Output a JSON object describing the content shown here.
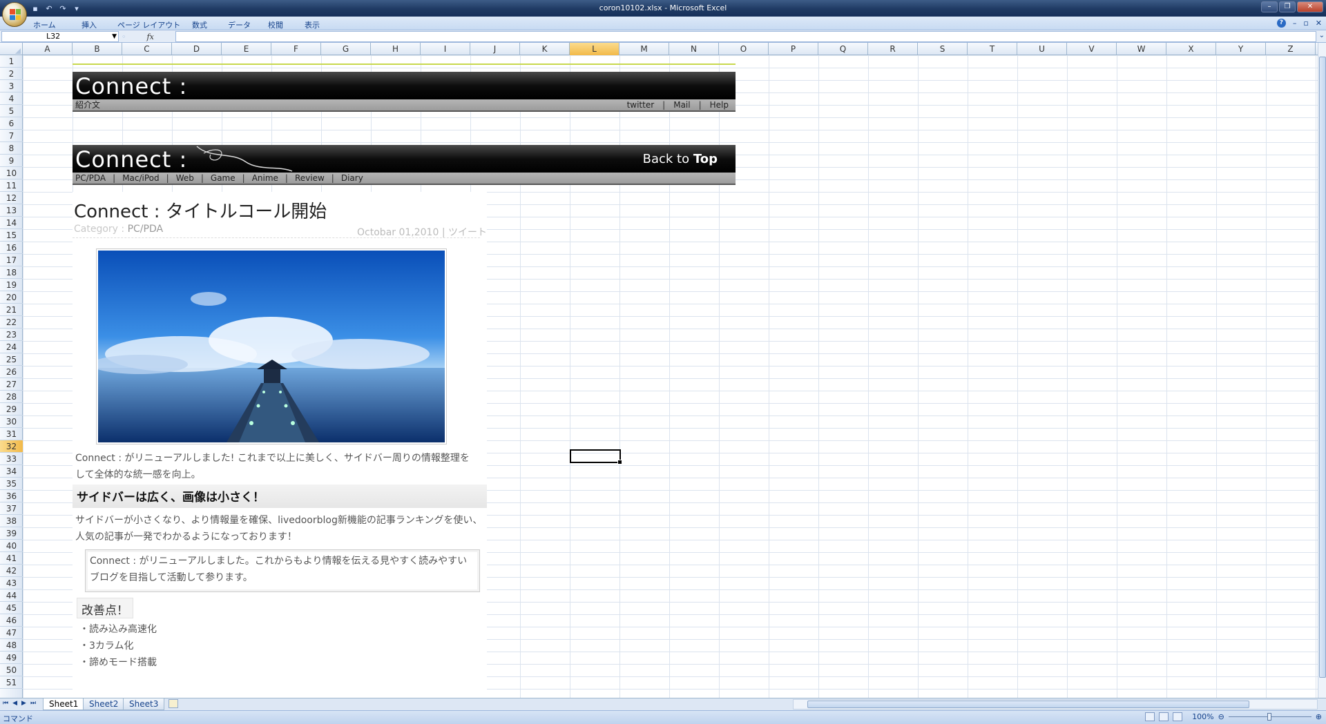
{
  "window": {
    "title": "coron10102.xlsx - Microsoft Excel"
  },
  "ribbon": {
    "tabs": [
      "ホーム",
      "挿入",
      "ページ レイアウト",
      "数式",
      "データ",
      "校閲",
      "表示"
    ]
  },
  "formula_bar": {
    "name_box": "L32",
    "formula": ""
  },
  "grid": {
    "columns": [
      "A",
      "B",
      "C",
      "D",
      "E",
      "F",
      "G",
      "H",
      "I",
      "J",
      "K",
      "L",
      "M",
      "N",
      "O",
      "P",
      "Q",
      "R",
      "S",
      "T",
      "U",
      "V",
      "W",
      "X",
      "Y",
      "Z"
    ],
    "active_column": "L",
    "active_row": 32,
    "row_count": 51
  },
  "header1": {
    "brand": "Connect :",
    "intro": "紹介文",
    "links": [
      "twitter",
      "Mail",
      "Help"
    ]
  },
  "header2": {
    "brand": "Connect :",
    "back_to": "Back to",
    "top": "Top",
    "nav": [
      "PC/PDA",
      "Mac/iPod",
      "Web",
      "Game",
      "Anime",
      "Review",
      "Diary"
    ]
  },
  "article": {
    "title": "Connect : タイトルコール開始",
    "category_label": "Category :",
    "category": "PC/PDA",
    "date": "Octobar 01,2010",
    "tweet": "ツイート",
    "p1": "Connect : がリニューアルしました! これまで以上に美しく、サイドバー周りの情報整理をして全体的な統一感を向上。",
    "h2": "サイドバーは広く、画像は小さく！",
    "p2": "サイドバーが小さくなり、より情報量を確保、livedoorblog新機能の記事ランキングを使い、人気の記事が一発でわかるようになっております！",
    "quote": "Connect : がリニューアルしました。これからもより情報を伝える見やすく読みやすいブログを目指して活動して参ります。",
    "h3": "改善点！",
    "list": [
      "・読み込み高速化",
      "・3カラム化",
      "・諦めモード搭載"
    ]
  },
  "sheets": {
    "tabs": [
      "Sheet1",
      "Sheet2",
      "Sheet3"
    ],
    "active": "Sheet1"
  },
  "status": {
    "mode": "コマンド",
    "zoom": "100%"
  }
}
